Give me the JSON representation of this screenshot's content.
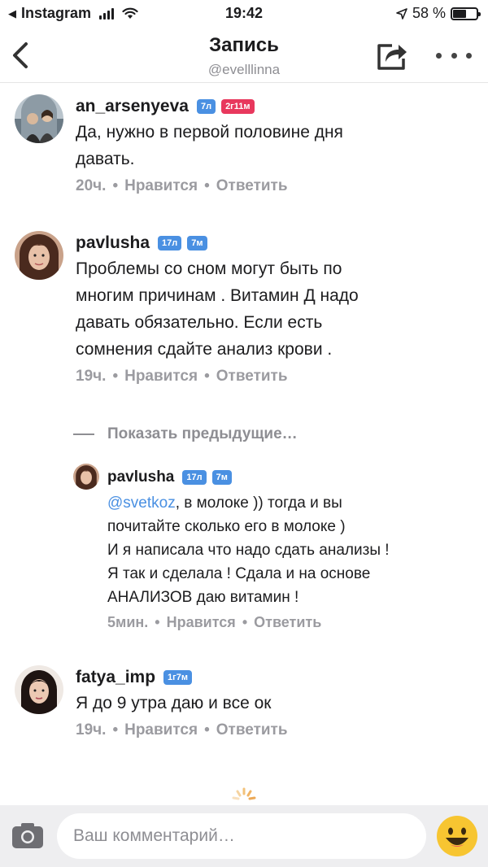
{
  "status_bar": {
    "back_app": "Instagram",
    "time": "19:42",
    "battery_percent": "58 %",
    "battery_level": 0.58
  },
  "header": {
    "title": "Запись",
    "subtitle": "@evelllinna"
  },
  "comments": [
    {
      "username": "an_arsenyeva",
      "badges": [
        "7л",
        "2г11м"
      ],
      "text_lines": [
        "Да, нужно в первой половине дня",
        "давать."
      ],
      "time": "20ч.",
      "like": "Нравится",
      "reply": "Ответить"
    },
    {
      "username": "pavlusha",
      "badges": [
        "17л",
        "7м"
      ],
      "text_lines": [
        "Проблемы со сном могут быть по",
        "многим причинам . Витамин Д надо",
        "давать обязательно. Если есть",
        "сомнения сдайте анализ крови ."
      ],
      "time": "19ч.",
      "like": "Нравится",
      "reply": "Ответить"
    },
    {
      "username": "fatya_imp",
      "badges": [
        "1г7м"
      ],
      "text_lines": [
        "Я до 9 утра даю и все ок"
      ],
      "time": "19ч.",
      "like": "Нравится",
      "reply": "Ответить"
    }
  ],
  "show_previous": "Показать предыдущие…",
  "reply": {
    "username": "pavlusha",
    "badges": [
      "17л",
      "7м"
    ],
    "mention": "@svetkoz",
    "first_line_rest": ", в молоке )) тогда и вы",
    "text_lines": [
      "почитайте сколько его в молоке )",
      "И я написала что надо сдать анализы !",
      "Я так и сделала ! Сдала и на основе",
      "АНАЛИЗОВ даю витамин !"
    ],
    "time": "5мин.",
    "like": "Нравится",
    "reply": "Ответить"
  },
  "input": {
    "placeholder": "Ваш комментарий…"
  },
  "colors": {
    "badge_blue": "#4a90e2",
    "badge_red": "#e8385d",
    "mention": "#4a90e2",
    "meta_gray": "#9b9ba0"
  }
}
